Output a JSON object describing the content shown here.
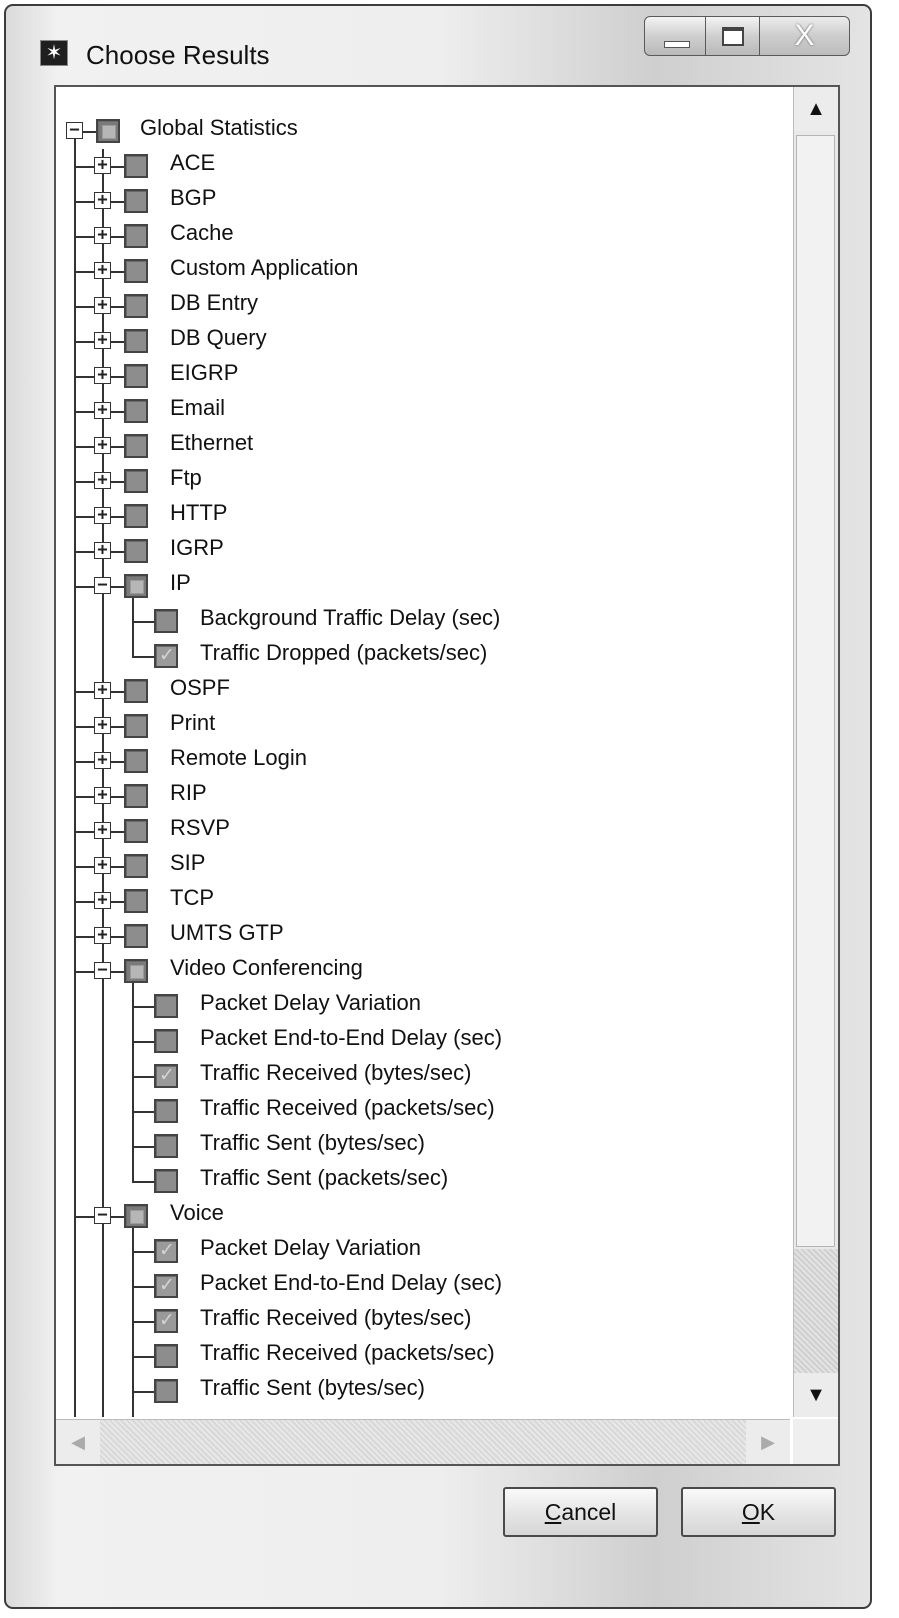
{
  "window": {
    "title": "Choose Results",
    "close_glyph": "X"
  },
  "tree": [
    {
      "label": "Global Statistics",
      "level": 0,
      "expander": "minus",
      "state": "partial"
    },
    {
      "label": "ACE",
      "level": 1,
      "expander": "plus",
      "state": "unchecked"
    },
    {
      "label": "BGP",
      "level": 1,
      "expander": "plus",
      "state": "unchecked"
    },
    {
      "label": "Cache",
      "level": 1,
      "expander": "plus",
      "state": "unchecked"
    },
    {
      "label": "Custom Application",
      "level": 1,
      "expander": "plus",
      "state": "unchecked"
    },
    {
      "label": "DB Entry",
      "level": 1,
      "expander": "plus",
      "state": "unchecked"
    },
    {
      "label": "DB Query",
      "level": 1,
      "expander": "plus",
      "state": "unchecked"
    },
    {
      "label": "EIGRP",
      "level": 1,
      "expander": "plus",
      "state": "unchecked"
    },
    {
      "label": "Email",
      "level": 1,
      "expander": "plus",
      "state": "unchecked"
    },
    {
      "label": "Ethernet",
      "level": 1,
      "expander": "plus",
      "state": "unchecked"
    },
    {
      "label": "Ftp",
      "level": 1,
      "expander": "plus",
      "state": "unchecked"
    },
    {
      "label": "HTTP",
      "level": 1,
      "expander": "plus",
      "state": "unchecked"
    },
    {
      "label": "IGRP",
      "level": 1,
      "expander": "plus",
      "state": "unchecked"
    },
    {
      "label": "IP",
      "level": 1,
      "expander": "minus",
      "state": "partial"
    },
    {
      "label": "Background Traffic Delay (sec)",
      "level": 2,
      "expander": "none",
      "state": "unchecked"
    },
    {
      "label": "Traffic Dropped (packets/sec)",
      "level": 2,
      "expander": "none",
      "state": "checked"
    },
    {
      "label": "OSPF",
      "level": 1,
      "expander": "plus",
      "state": "unchecked"
    },
    {
      "label": "Print",
      "level": 1,
      "expander": "plus",
      "state": "unchecked"
    },
    {
      "label": "Remote Login",
      "level": 1,
      "expander": "plus",
      "state": "unchecked"
    },
    {
      "label": "RIP",
      "level": 1,
      "expander": "plus",
      "state": "unchecked"
    },
    {
      "label": "RSVP",
      "level": 1,
      "expander": "plus",
      "state": "unchecked"
    },
    {
      "label": "SIP",
      "level": 1,
      "expander": "plus",
      "state": "unchecked"
    },
    {
      "label": "TCP",
      "level": 1,
      "expander": "plus",
      "state": "unchecked"
    },
    {
      "label": "UMTS GTP",
      "level": 1,
      "expander": "plus",
      "state": "unchecked"
    },
    {
      "label": "Video Conferencing",
      "level": 1,
      "expander": "minus",
      "state": "partial"
    },
    {
      "label": "Packet Delay Variation",
      "level": 2,
      "expander": "none",
      "state": "unchecked"
    },
    {
      "label": "Packet End-to-End Delay (sec)",
      "level": 2,
      "expander": "none",
      "state": "unchecked"
    },
    {
      "label": "Traffic Received (bytes/sec)",
      "level": 2,
      "expander": "none",
      "state": "checked"
    },
    {
      "label": "Traffic Received (packets/sec)",
      "level": 2,
      "expander": "none",
      "state": "unchecked"
    },
    {
      "label": "Traffic Sent (bytes/sec)",
      "level": 2,
      "expander": "none",
      "state": "unchecked"
    },
    {
      "label": "Traffic Sent (packets/sec)",
      "level": 2,
      "expander": "none",
      "state": "unchecked"
    },
    {
      "label": "Voice",
      "level": 1,
      "expander": "minus",
      "state": "partial"
    },
    {
      "label": "Packet Delay Variation",
      "level": 2,
      "expander": "none",
      "state": "checked"
    },
    {
      "label": "Packet End-to-End Delay (sec)",
      "level": 2,
      "expander": "none",
      "state": "checked"
    },
    {
      "label": "Traffic Received (bytes/sec)",
      "level": 2,
      "expander": "none",
      "state": "checked"
    },
    {
      "label": "Traffic Received (packets/sec)",
      "level": 2,
      "expander": "none",
      "state": "unchecked"
    },
    {
      "label": "Traffic Sent (bytes/sec)",
      "level": 2,
      "expander": "none",
      "state": "unchecked"
    }
  ],
  "buttons": {
    "cancel": {
      "mnemonic": "C",
      "rest": "ancel"
    },
    "ok": {
      "mnemonic": "O",
      "rest": "K"
    }
  },
  "scrollbars": {
    "up_glyph": "▲",
    "down_glyph": "▼",
    "left_glyph": "◀",
    "right_glyph": "▶"
  }
}
